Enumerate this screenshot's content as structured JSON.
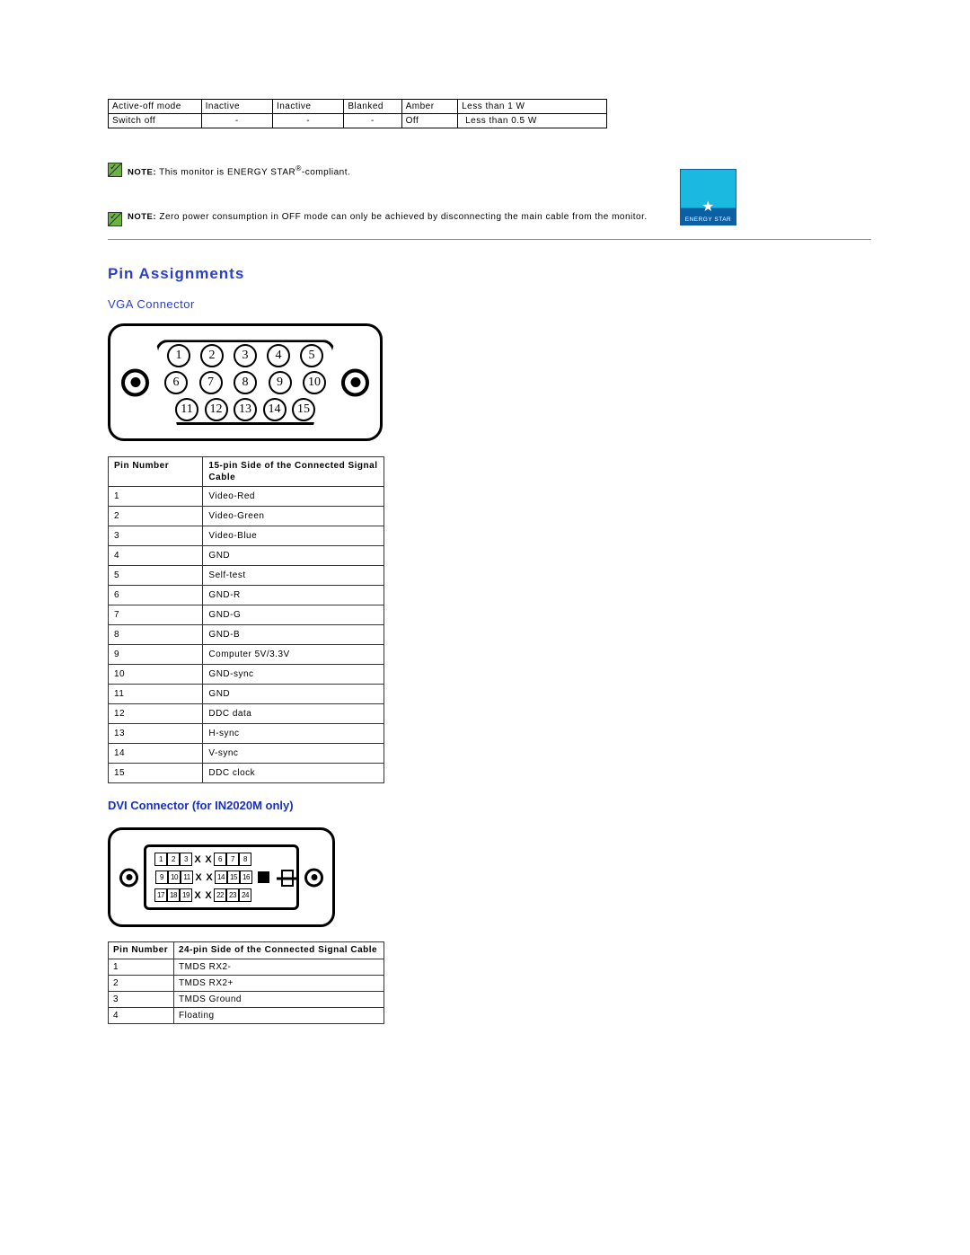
{
  "power_table": {
    "rows": [
      {
        "mode": "Active-off mode",
        "h": "Inactive",
        "v": "Inactive",
        "video": "Blanked",
        "indicator": "Amber",
        "power": "Less than 1 W"
      },
      {
        "mode": "Switch off",
        "h": "-",
        "v": "-",
        "video": "-",
        "indicator": "Off",
        "power": "Less than 0.5 W"
      }
    ]
  },
  "notes": {
    "n1_prefix": "NOTE:",
    "n1_text1": " This monitor is ENERGY STAR",
    "n1_reg": "®",
    "n1_text2": "-compliant.",
    "n2_prefix": "NOTE:",
    "n2_text": " Zero power consumption in OFF mode can only be achieved by disconnecting the main cable from the monitor."
  },
  "energy_star": {
    "label": "ENERGY STAR"
  },
  "titles": {
    "pin_assignments": "Pin Assignments",
    "vga_connector": "VGA Connector",
    "dvi_connector": "DVI Connector (for IN2020M only)"
  },
  "vga_table": {
    "headers": {
      "pin": "Pin Number",
      "desc": "15-pin Side of the Connected Signal Cable"
    },
    "rows": [
      {
        "pin": "1",
        "desc": "Video-Red"
      },
      {
        "pin": "2",
        "desc": "Video-Green"
      },
      {
        "pin": "3",
        "desc": "Video-Blue"
      },
      {
        "pin": "4",
        "desc": "GND"
      },
      {
        "pin": "5",
        "desc": "Self-test"
      },
      {
        "pin": "6",
        "desc": "GND-R"
      },
      {
        "pin": "7",
        "desc": "GND-G"
      },
      {
        "pin": "8",
        "desc": "GND-B"
      },
      {
        "pin": "9",
        "desc": "Computer 5V/3.3V"
      },
      {
        "pin": "10",
        "desc": "GND-sync"
      },
      {
        "pin": "11",
        "desc": "GND"
      },
      {
        "pin": "12",
        "desc": "DDC data"
      },
      {
        "pin": "13",
        "desc": "H-sync"
      },
      {
        "pin": "14",
        "desc": "V-sync"
      },
      {
        "pin": "15",
        "desc": "DDC clock"
      }
    ]
  },
  "dvi_table": {
    "headers": {
      "pin": "Pin Number",
      "desc": "24-pin Side of the Connected Signal Cable"
    },
    "rows": [
      {
        "pin": "1",
        "desc": "TMDS RX2-"
      },
      {
        "pin": "2",
        "desc": "TMDS RX2+"
      },
      {
        "pin": "3",
        "desc": "TMDS Ground"
      },
      {
        "pin": "4",
        "desc": "Floating"
      }
    ]
  },
  "vga_pins": {
    "row1": [
      "1",
      "2",
      "3",
      "4",
      "5"
    ],
    "row2": [
      "6",
      "7",
      "8",
      "9",
      "10"
    ],
    "row3": [
      "11",
      "12",
      "13",
      "14",
      "15"
    ]
  },
  "dvi_pins": {
    "row1": [
      "1",
      "2",
      "3"
    ],
    "row1b": [
      "6",
      "7",
      "8"
    ],
    "row2": [
      "9",
      "10",
      "11"
    ],
    "row2b": [
      "14",
      "15",
      "16"
    ],
    "row3": [
      "17",
      "18",
      "19"
    ],
    "row3b": [
      "22",
      "23",
      "24"
    ]
  }
}
